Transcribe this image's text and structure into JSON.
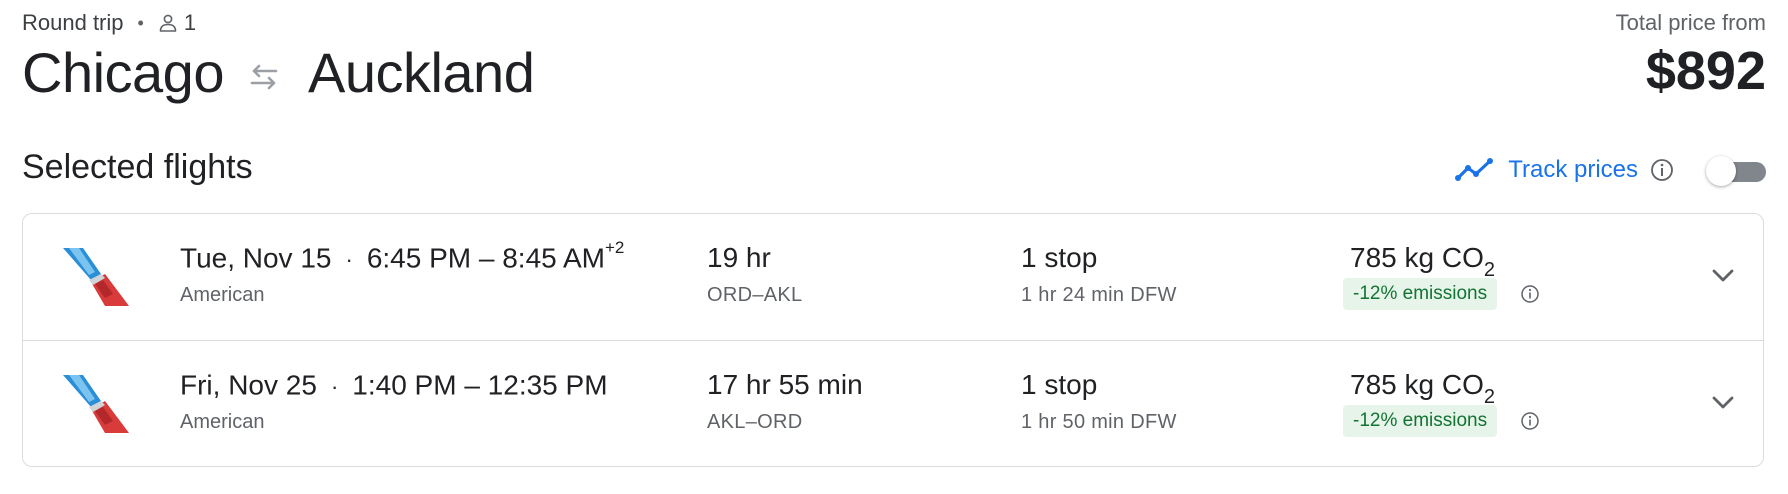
{
  "header": {
    "trip_type": "Round trip",
    "passengers": "1",
    "origin": "Chicago",
    "destination": "Auckland",
    "price_label": "Total price from",
    "price": "$892"
  },
  "section": {
    "title": "Selected flights",
    "track_label": "Track prices",
    "track_enabled": false
  },
  "icons": {
    "person": "person-icon",
    "swap": "swap-arrows-icon",
    "trend": "trend-line-icon",
    "info": "info-icon",
    "chevron": "chevron-down-icon",
    "airline_logo": "american-airlines-logo"
  },
  "colors": {
    "accent": "#1a73e8",
    "emissions_bg": "#e6f4ea",
    "emissions_text": "#137333",
    "logo_blue": "#2a8fd6",
    "logo_red": "#d93a3a"
  },
  "flights": [
    {
      "date": "Tue, Nov 15",
      "time_range": "6:45 PM – 8:45 AM",
      "day_offset": "+2",
      "airline": "American",
      "duration": "19 hr",
      "airports": "ORD–AKL",
      "stops": "1 stop",
      "layover": "1 hr 24 min DFW",
      "co2_value": "785 kg CO",
      "co2_sub": "2",
      "emissions": "-12% emissions"
    },
    {
      "date": "Fri, Nov 25",
      "time_range": "1:40 PM – 12:35 PM",
      "day_offset": "",
      "airline": "American",
      "duration": "17 hr 55 min",
      "airports": "AKL–ORD",
      "stops": "1 stop",
      "layover": "1 hr 50 min DFW",
      "co2_value": "785 kg CO",
      "co2_sub": "2",
      "emissions": "-12% emissions"
    }
  ]
}
